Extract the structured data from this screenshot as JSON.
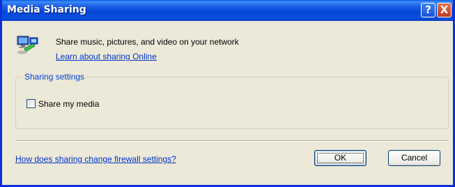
{
  "window": {
    "title": "Media Sharing",
    "help_label": "?",
    "close_label": "X"
  },
  "intro": {
    "text": "Share music, pictures, and video on your network",
    "link": "Learn about sharing Online"
  },
  "sharing_settings": {
    "group_label": "Sharing settings",
    "checkbox_label": "Share my media",
    "checked": false
  },
  "footer": {
    "firewall_link": "How does sharing change firewall settings?",
    "ok_label": "OK",
    "cancel_label": "Cancel"
  },
  "colors": {
    "titlebar": "#0a50e0",
    "link": "#0033cc",
    "group_label": "#0046d5",
    "dialog_bg": "#ece9d8"
  }
}
